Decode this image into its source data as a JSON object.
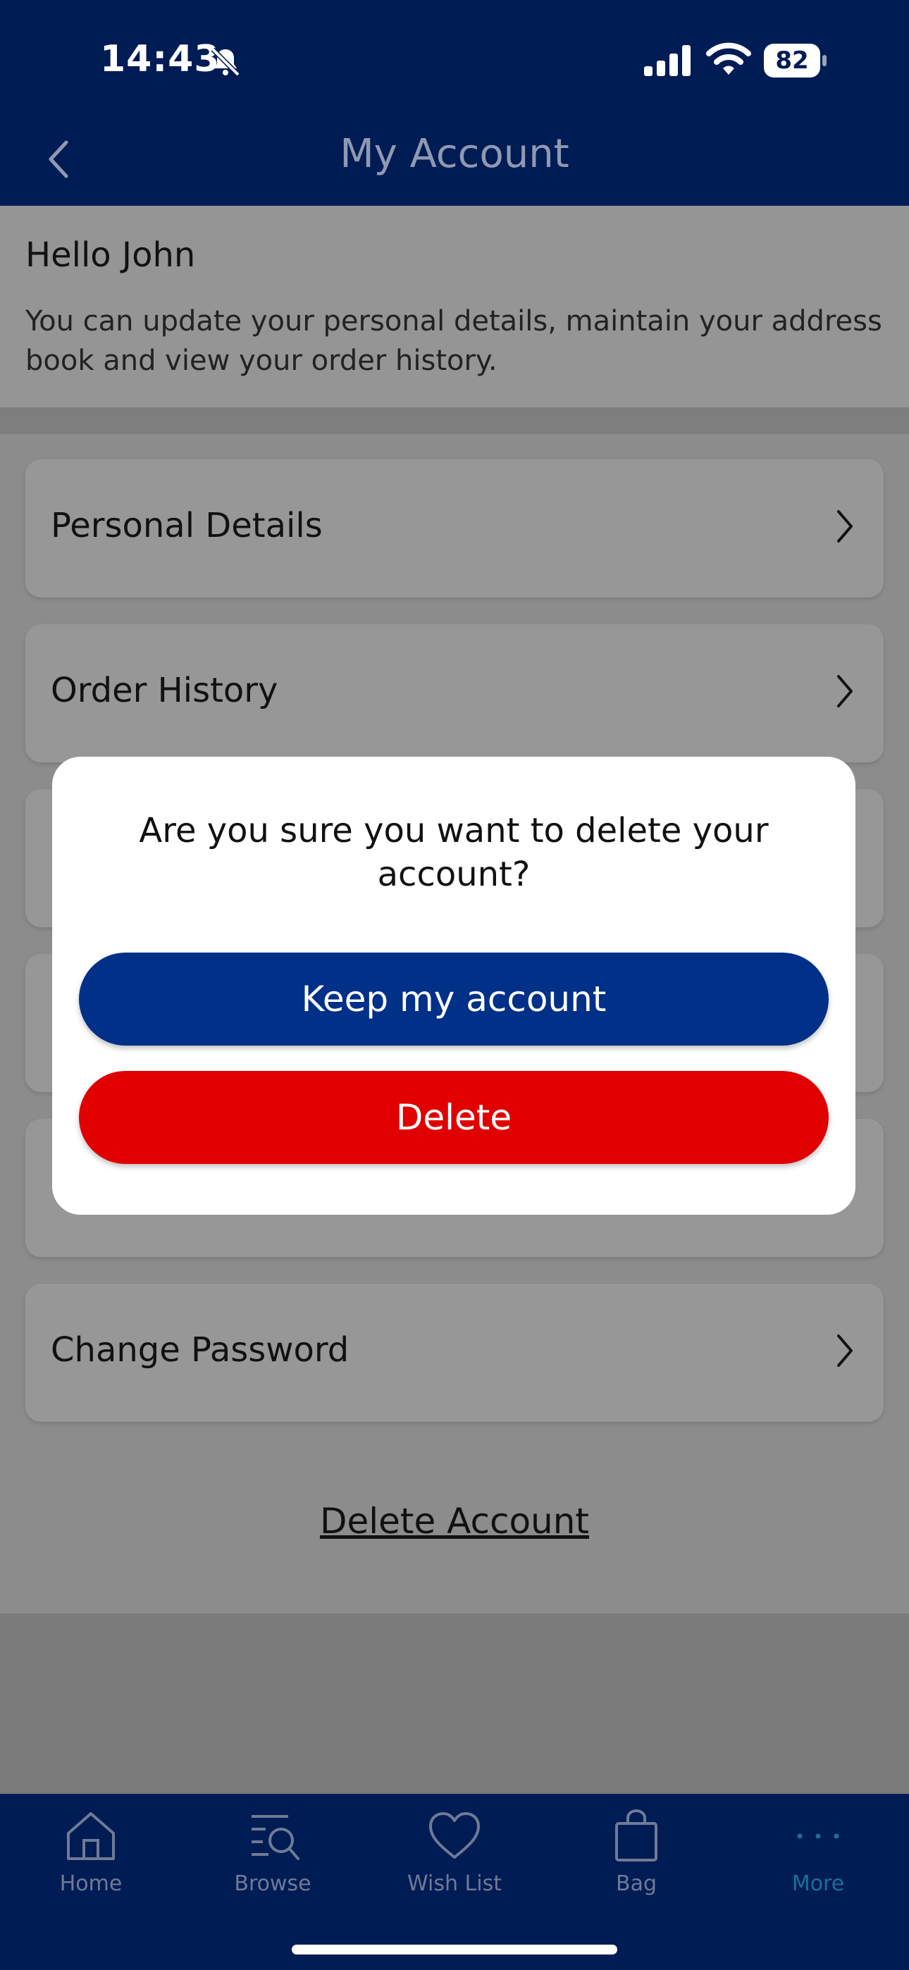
{
  "status_bar": {
    "time": "14:43",
    "battery": "82"
  },
  "header": {
    "title": "My Account"
  },
  "greeting": {
    "title": "Hello John",
    "description": "You can update your personal details, maintain your address book and view your order history."
  },
  "menu": {
    "items": [
      {
        "label": "Personal Details"
      },
      {
        "label": "Order History"
      },
      {
        "label": "Change Password"
      }
    ],
    "delete_link": "Delete Account"
  },
  "modal": {
    "question": "Are you sure you want to delete your account?",
    "keep_label": "Keep my account",
    "delete_label": "Delete"
  },
  "tabbar": {
    "items": [
      {
        "label": "Home",
        "icon": "home-icon"
      },
      {
        "label": "Browse",
        "icon": "browse-icon"
      },
      {
        "label": "Wish List",
        "icon": "heart-icon"
      },
      {
        "label": "Bag",
        "icon": "bag-icon"
      },
      {
        "label": "More",
        "icon": "more-icon"
      }
    ],
    "active": "More"
  },
  "colors": {
    "header_bg": "#001c55",
    "keep_button": "#003087",
    "delete_button": "#e10000",
    "active_tab": "#1b6e9a"
  }
}
